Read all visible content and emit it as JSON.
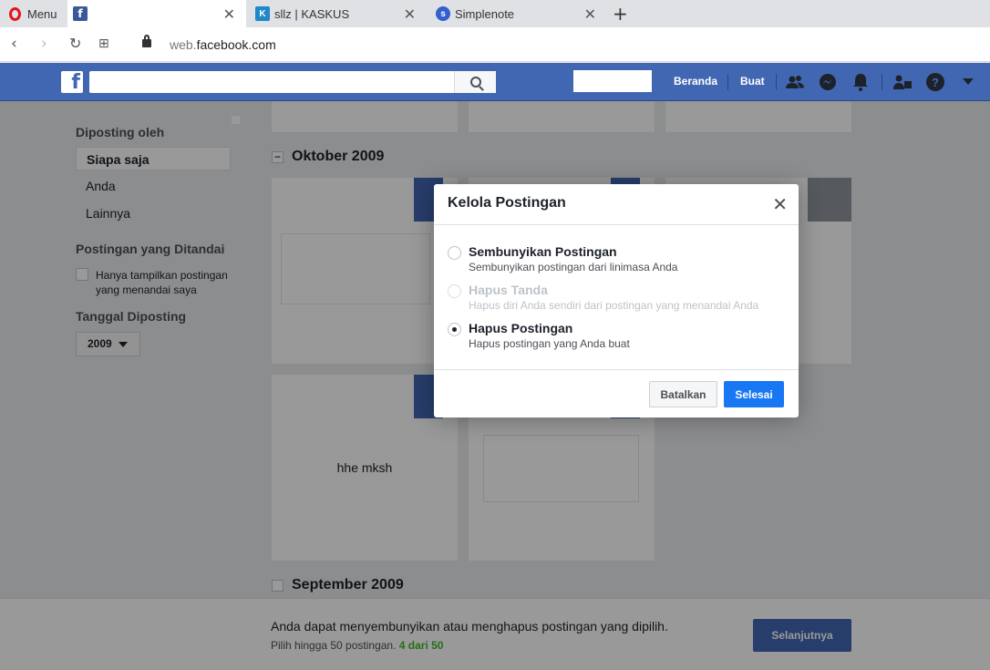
{
  "browser": {
    "menu_label": "Menu",
    "tabs": [
      {
        "title": "",
        "icon": "facebook-icon"
      },
      {
        "title": "sllz | KASKUS",
        "icon": "kaskus-icon"
      },
      {
        "title": "Simplenote",
        "icon": "simplenote-icon"
      }
    ],
    "url_host": "web.facebook.com",
    "url_prefix": "web.",
    "url_domain": "facebook.com"
  },
  "fb_header": {
    "home_label": "Beranda",
    "create_label": "Buat"
  },
  "sidebar": {
    "posted_by_heading": "Diposting oleh",
    "posted_by_items": [
      "Siapa saja",
      "Anda",
      "Lainnya"
    ],
    "tagged_heading": "Postingan yang Ditandai",
    "tagged_checkbox_label": "Hanya tampilkan postingan yang menandai saya",
    "date_heading": "Tanggal Diposting",
    "year_value": "2009"
  },
  "timeline": {
    "months": [
      "Oktober 2009",
      "September 2009"
    ],
    "post_text": "hhe mksh"
  },
  "dialog": {
    "title": "Kelola Postingan",
    "options": [
      {
        "title": "Sembunyikan Postingan",
        "desc": "Sembunyikan postingan dari linimasa Anda",
        "selected": false,
        "disabled": false
      },
      {
        "title": "Hapus Tanda",
        "desc": "Hapus diri Anda sendiri dari postingan yang menandai Anda",
        "selected": false,
        "disabled": true
      },
      {
        "title": "Hapus Postingan",
        "desc": "Hapus postingan yang Anda buat",
        "selected": true,
        "disabled": false
      }
    ],
    "cancel_label": "Batalkan",
    "done_label": "Selesai"
  },
  "footer": {
    "main_text": "Anda dapat menyembunyikan atau menghapus postingan yang dipilih.",
    "sub_text": "Pilih hingga 50 postingan.",
    "count_text": "4 dari 50",
    "next_label": "Selanjutnya"
  },
  "colors": {
    "fb_blue": "#4267b2",
    "primary_button": "#1877f2",
    "count_green": "#42b72a"
  }
}
